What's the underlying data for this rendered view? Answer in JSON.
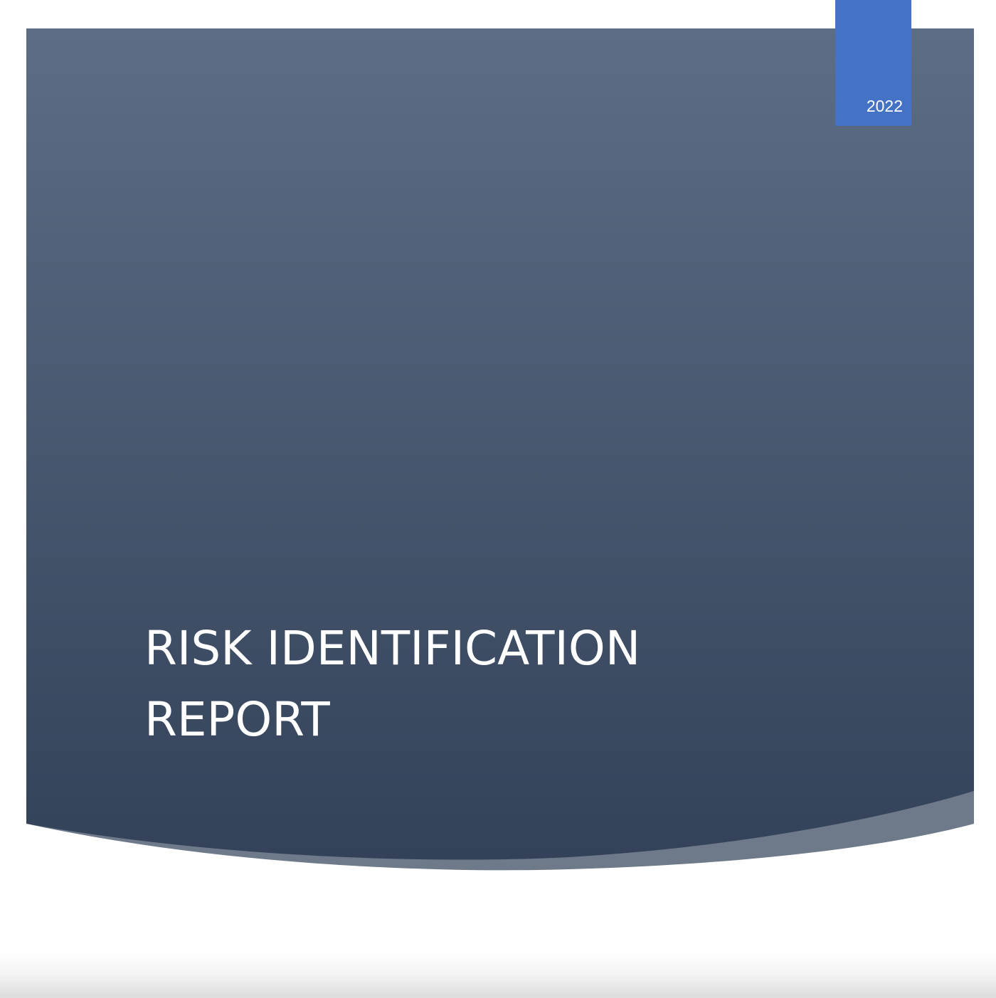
{
  "cover": {
    "year": "2022",
    "title_line1": "RISK IDENTIFICATION",
    "title_line2": "REPORT"
  },
  "colors": {
    "panel_top": "#5d6d85",
    "panel_bottom": "#334259",
    "accent_curve": "#6e7a8a",
    "year_tab": "#4472c4",
    "title_text": "#ffffff"
  }
}
